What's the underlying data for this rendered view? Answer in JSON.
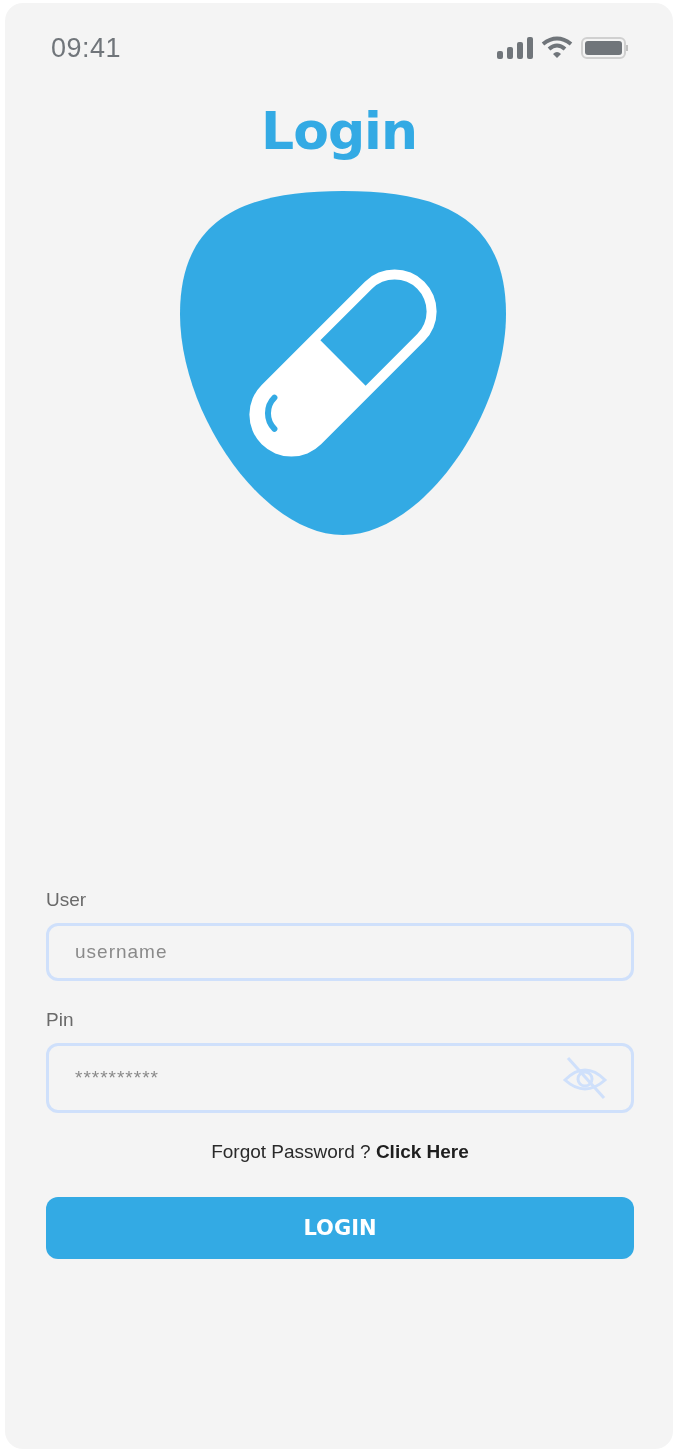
{
  "status_bar": {
    "time": "09:41"
  },
  "title": "Login",
  "fields": [
    {
      "label": "User",
      "placeholder": "username",
      "kind": "text"
    },
    {
      "label": "Pin",
      "value": "**********",
      "kind": "password"
    }
  ],
  "forgot": {
    "text": "Forgot Password ? ",
    "link": "Click Here"
  },
  "login_button": "LOGIN"
}
